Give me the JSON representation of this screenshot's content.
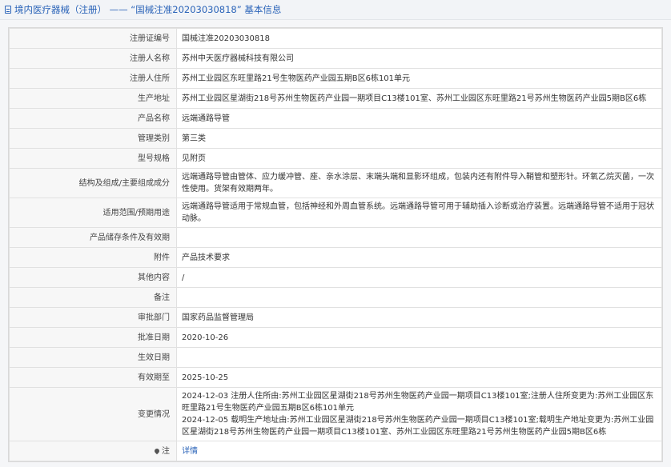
{
  "header": {
    "title": "境内医疗器械（注册） —— “国械注准20203030818” 基本信息"
  },
  "rows": [
    {
      "label": "注册证编号",
      "value": "国械注准20203030818"
    },
    {
      "label": "注册人名称",
      "value": "苏州中天医疗器械科技有限公司"
    },
    {
      "label": "注册人住所",
      "value": "苏州工业园区东旺里路21号生物医药产业园五期B区6栋101单元"
    },
    {
      "label": "生产地址",
      "value": "苏州工业园区星湖街218号苏州生物医药产业园一期项目C13楼101室、苏州工业园区东旺里路21号苏州生物医药产业园5期B区6栋"
    },
    {
      "label": "产品名称",
      "value": "远端通路导管"
    },
    {
      "label": "管理类别",
      "value": "第三类"
    },
    {
      "label": "型号规格",
      "value": "见附页"
    },
    {
      "label": "结构及组成/主要组成成分",
      "value": "远端通路导管由管体、应力缓冲管、座、亲水涂层、末端头端和显影环组成，包装内还有附件导入鞘管和塑形针。环氧乙烷灭菌，一次性使用。货架有效期两年。"
    },
    {
      "label": "适用范围/预期用途",
      "value": "远端通路导管适用于常规血管，包括神经和外周血管系统。远端通路导管可用于辅助插入诊断或治疗装置。远端通路导管不适用于冠状动脉。"
    },
    {
      "label": "产品储存条件及有效期",
      "value": ""
    },
    {
      "label": "附件",
      "value": "产品技术要求"
    },
    {
      "label": "其他内容",
      "value": "/"
    },
    {
      "label": "备注",
      "value": ""
    },
    {
      "label": "审批部门",
      "value": "国家药品监督管理局"
    },
    {
      "label": "批准日期",
      "value": "2020-10-26"
    },
    {
      "label": "生效日期",
      "value": ""
    },
    {
      "label": "有效期至",
      "value": "2025-10-25"
    }
  ],
  "changes": {
    "label": "变更情况",
    "entries": [
      "2024-12-03 注册人住所由:苏州工业园区星湖街218号苏州生物医药产业园一期项目C13楼101室;注册人住所变更为:苏州工业园区东旺里路21号生物医药产业园五期B区6栋101单元",
      "2024-12-05 载明生产地址由:苏州工业园区星湖街218号苏州生物医药产业园一期项目C13楼101室;载明生产地址变更为:苏州工业园区星湖街218号苏州生物医药产业园一期项目C13楼101室、苏州工业园区东旺里路21号苏州生物医药产业园5期B区6栋"
    ]
  },
  "note": {
    "label": "注",
    "link": "详情"
  }
}
